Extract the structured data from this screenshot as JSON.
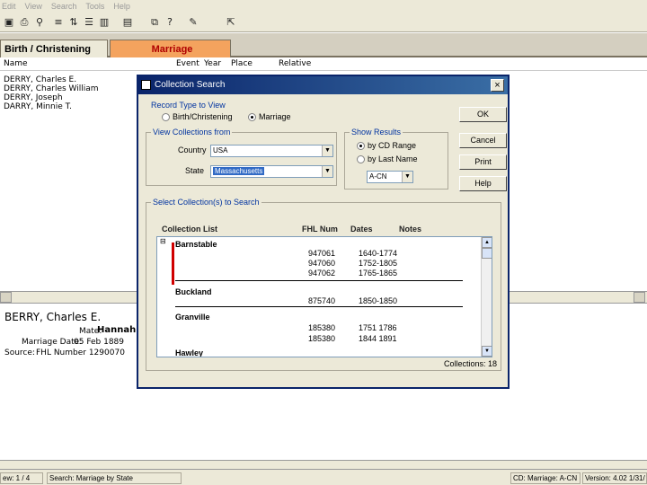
{
  "menubar": {
    "items": [
      "Edit",
      "View",
      "Search",
      "Tools",
      "Help"
    ]
  },
  "toolbar": {
    "icons": [
      "save-icon",
      "print-icon",
      "find-icon",
      "filter-icon",
      "sort-icon",
      "list-icon",
      "columns-icon",
      "book-icon",
      "copy-icon",
      "help-icon",
      "export-icon"
    ]
  },
  "tabs": {
    "birth": "Birth / Christening",
    "marriage": "Marriage"
  },
  "columns": {
    "name": "Name",
    "event": "Event",
    "year": "Year",
    "place": "Place",
    "relative": "Relative"
  },
  "names": [
    "DERRY, Charles E.",
    "DERRY, Charles William",
    "DERRY, Joseph",
    "DARRY, Minnie T."
  ],
  "details": {
    "name": "BERRY, Charles E.",
    "spouse_label": "Mate:",
    "spouse": "Hannah ELLIS",
    "date_label": "Marriage Date:",
    "date": "05 Feb 1889",
    "source_label": "Source:",
    "source": "FHL Number 1290070"
  },
  "status": {
    "record": "ew: 1 / 4",
    "search": "Search: Marriage by State",
    "collection": "CD: Marriage: A-CN",
    "version": "Version: 4.02 1/31/"
  },
  "dialog": {
    "title": "Collection Search",
    "close": "×",
    "record_type_title": "Record Type to View",
    "rt_birth": "Birth/Christening",
    "rt_marriage": "Marriage",
    "view_collections_title": "View Collections from",
    "country_label": "Country",
    "country_value": "USA",
    "state_label": "State",
    "state_value": "Massachusetts",
    "show_results_title": "Show Results",
    "by_cd": "by CD Range",
    "by_last": "by Last Name",
    "cd_range": "A-CN",
    "buttons": {
      "ok": "OK",
      "cancel": "Cancel",
      "print": "Print",
      "help": "Help"
    },
    "select_title": "Select Collection(s) to Search",
    "list_headers": {
      "list": "Collection List",
      "fhl": "FHL Num",
      "dates": "Dates",
      "notes": "Notes"
    },
    "collections": [
      {
        "name": "Barnstable",
        "rows": [
          [
            "947061",
            "1640-1774"
          ],
          [
            "947060",
            "1752-1805"
          ],
          [
            "947062",
            "1765-1865"
          ]
        ]
      },
      {
        "name": "Buckland",
        "rows": [
          [
            "875740",
            "1850-1850"
          ]
        ]
      },
      {
        "name": "Granville",
        "rows": [
          [
            "185380",
            "1751 1786"
          ],
          [
            "185380",
            "1844 1891"
          ]
        ]
      },
      {
        "name": "Hawley",
        "rows": []
      }
    ],
    "collections_count": "Collections: 18"
  }
}
